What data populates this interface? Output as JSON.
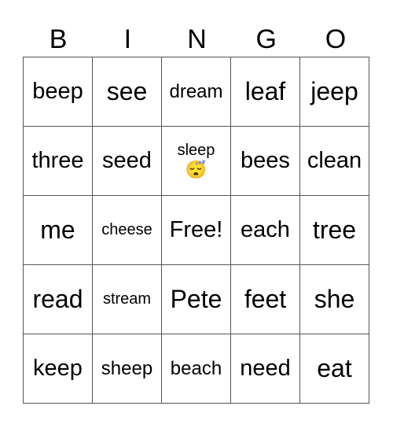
{
  "title_letters": [
    "B",
    "I",
    "N",
    "G",
    "O"
  ],
  "rows": [
    [
      {
        "text": "beep",
        "size": "s2"
      },
      {
        "text": "see",
        "size": "s1"
      },
      {
        "text": "dream",
        "size": "s3"
      },
      {
        "text": "leaf",
        "size": "s1"
      },
      {
        "text": "jeep",
        "size": "s1"
      }
    ],
    [
      {
        "text": "three",
        "size": "s2"
      },
      {
        "text": "seed",
        "size": "s2"
      },
      {
        "text": "sleep",
        "size": "s4",
        "emoji": "😴"
      },
      {
        "text": "bees",
        "size": "s2"
      },
      {
        "text": "clean",
        "size": "s2"
      }
    ],
    [
      {
        "text": "me",
        "size": "s1"
      },
      {
        "text": "cheese",
        "size": "s4"
      },
      {
        "text": "Free!",
        "size": "s2"
      },
      {
        "text": "each",
        "size": "s2"
      },
      {
        "text": "tree",
        "size": "s1"
      }
    ],
    [
      {
        "text": "read",
        "size": "s1"
      },
      {
        "text": "stream",
        "size": "s4"
      },
      {
        "text": "Pete",
        "size": "s1"
      },
      {
        "text": "feet",
        "size": "s1"
      },
      {
        "text": "she",
        "size": "s1"
      }
    ],
    [
      {
        "text": "keep",
        "size": "s2"
      },
      {
        "text": "sheep",
        "size": "s3"
      },
      {
        "text": "beach",
        "size": "s3"
      },
      {
        "text": "need",
        "size": "s2"
      },
      {
        "text": "eat",
        "size": "s1"
      }
    ]
  ]
}
